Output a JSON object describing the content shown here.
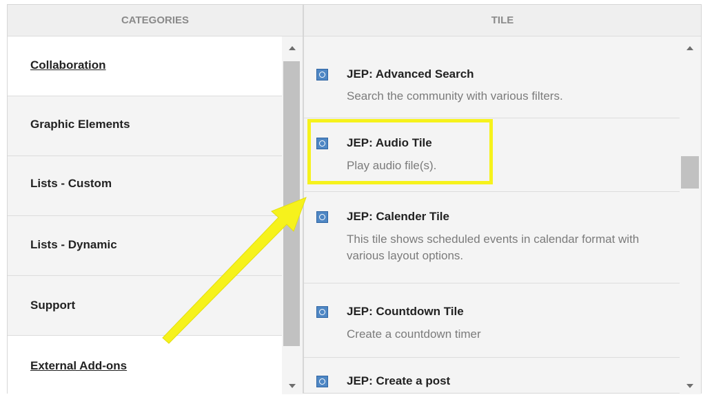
{
  "categories_header": "CATEGORIES",
  "tile_header": "TILE",
  "categories": [
    {
      "label": "Collaboration",
      "link": true
    },
    {
      "label": "Graphic Elements",
      "link": false
    },
    {
      "label": "Lists - Custom",
      "link": false
    },
    {
      "label": "Lists - Dynamic",
      "link": false
    },
    {
      "label": "Support",
      "link": false
    },
    {
      "label": "External Add-ons",
      "link": true
    }
  ],
  "tiles": [
    {
      "title": "JEP: Advanced Search",
      "description": "Search the community with various filters."
    },
    {
      "title": "JEP: Audio Tile",
      "description": "Play audio file(s)."
    },
    {
      "title": "JEP: Calender Tile",
      "description": "This tile shows scheduled events in calendar format with various layout options."
    },
    {
      "title": "JEP: Countdown Tile",
      "description": "Create a countdown timer"
    },
    {
      "title": "JEP: Create a post",
      "description": ""
    }
  ],
  "icons": {
    "tile_icon": "tile-icon",
    "scroll_up": "scroll-up-icon",
    "scroll_down": "scroll-down-icon"
  },
  "colors": {
    "highlight": "#f6f21c",
    "icon_blue": "#4f87c4"
  }
}
